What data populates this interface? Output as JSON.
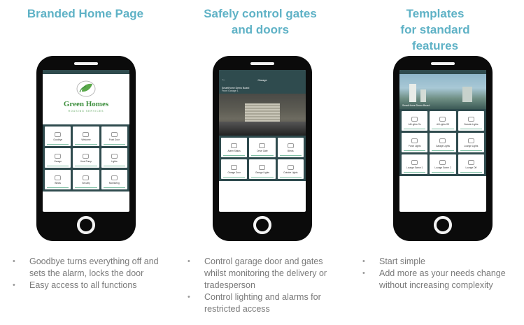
{
  "columns": [
    {
      "title": "Branded Home Page",
      "bullets": [
        "Goodbye turns everything off and sets the alarm, locks the door",
        "Easy access to all functions"
      ],
      "phone": {
        "logo_text": "Green Homes",
        "logo_sub": "HOUSING SERVICES",
        "tiles": [
          "Goodbye",
          "Welcome",
          "Front Door",
          "Garage",
          "Heat Pump",
          "Lights",
          "Blinds",
          "Security",
          "Monitoring"
        ]
      }
    },
    {
      "title": "Safely control gates\nand doors",
      "bullets": [
        "Control garage door and gates whilst monitoring the delivery or tradesperson",
        "Control lighting and alarms for restricted access"
      ],
      "phone": {
        "appbar_title": "Garage",
        "cam_title": "SmartHome Demo Board",
        "cam_sub": "Front Garage 1",
        "tiles": [
          "Alarm Status",
          "Drive Gate",
          "Blinds",
          "Garage Door",
          "Garage Lights",
          "Outside Lights"
        ]
      }
    },
    {
      "title": "Templates\nfor standard\nfeatures",
      "bullets": [
        "Start simple",
        "Add more as your needs change without increasing complexity"
      ],
      "phone": {
        "hero_caption": "SmartHome Demo Board",
        "tiles": [
          "All Lights On",
          "All Lights Off",
          "Outside Lights",
          "Porch Lights",
          "Garage Lights",
          "Lounge Lights",
          "Lounge Scene 1",
          "Lounge Scene 2",
          "Lounge Off"
        ]
      }
    }
  ],
  "colors": {
    "title": "#5fb2c6",
    "app_header": "#2f4b4e",
    "bullet_text": "#7a7a7a"
  }
}
